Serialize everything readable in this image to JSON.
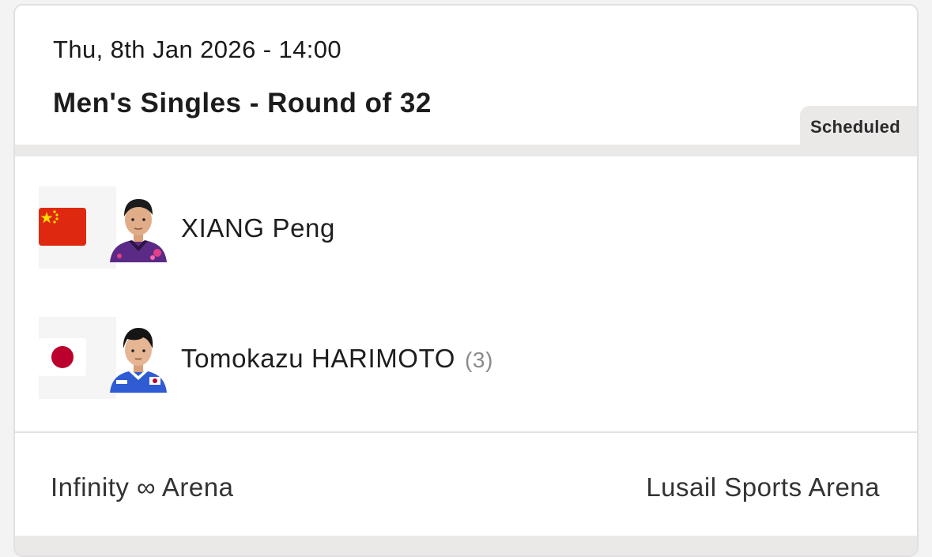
{
  "match": {
    "datetime": "Thu, 8th Jan 2026 - 14:00",
    "title": "Men's Singles - Round of 32",
    "status": "Scheduled"
  },
  "players": [
    {
      "name": "XIANG Peng",
      "seed": "",
      "flag": "china-flag-icon",
      "avatar": "player-photo-xiang"
    },
    {
      "name": "Tomokazu HARIMOTO",
      "seed": "(3)",
      "flag": "japan-flag-icon",
      "avatar": "player-photo-harimoto"
    }
  ],
  "venue": {
    "court": "Infinity ∞ Arena",
    "arena": "Lusail Sports Arena"
  },
  "colors": {
    "china_red": "#de2910",
    "china_star": "#ffde00",
    "japan_red": "#bc002d",
    "badge_bg": "#ebe8e8"
  }
}
